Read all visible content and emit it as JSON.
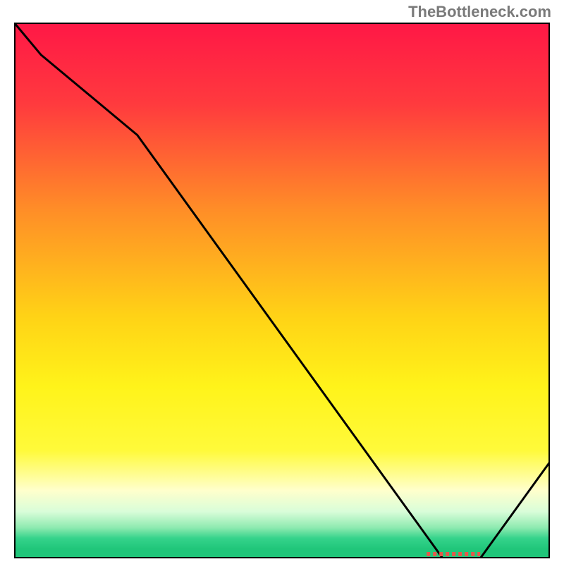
{
  "attribution": "TheBottleneck.com",
  "chart_data": {
    "type": "line",
    "title": "",
    "xlabel": "",
    "ylabel": "",
    "x": [
      0,
      5,
      23,
      80,
      87,
      100
    ],
    "values": [
      100,
      94,
      79,
      0,
      0,
      18
    ],
    "xlim": [
      0,
      100
    ],
    "ylim": [
      0,
      100
    ],
    "marker": {
      "x_start": 77,
      "x_end": 87,
      "label": ""
    },
    "gradient_stops": [
      {
        "offset": 0.0,
        "color": "#ff1846"
      },
      {
        "offset": 0.15,
        "color": "#ff3a3e"
      },
      {
        "offset": 0.35,
        "color": "#ff8e27"
      },
      {
        "offset": 0.55,
        "color": "#ffd316"
      },
      {
        "offset": 0.68,
        "color": "#fff31a"
      },
      {
        "offset": 0.8,
        "color": "#fffa3a"
      },
      {
        "offset": 0.875,
        "color": "#ffffcc"
      },
      {
        "offset": 0.915,
        "color": "#d9fdd9"
      },
      {
        "offset": 0.945,
        "color": "#8eeab0"
      },
      {
        "offset": 0.965,
        "color": "#35d38b"
      },
      {
        "offset": 0.985,
        "color": "#20c67a"
      }
    ]
  }
}
